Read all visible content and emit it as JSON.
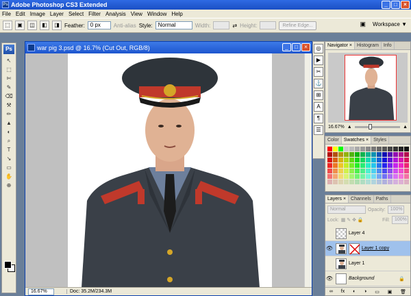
{
  "app": {
    "title": "Adobe Photoshop CS3 Extended",
    "window_buttons": [
      "_",
      "□",
      "×"
    ]
  },
  "menu": [
    "File",
    "Edit",
    "Image",
    "Layer",
    "Select",
    "Filter",
    "Analysis",
    "View",
    "Window",
    "Help"
  ],
  "options_bar": {
    "feather_label": "Feather:",
    "feather_value": "0 px",
    "antialias_label": "Anti-alias",
    "style_label": "Style:",
    "style_value": "Normal",
    "width_label": "Width:",
    "height_label": "Height:",
    "refine_label": "Refine Edge...",
    "workspace_label": "Workspace ▼"
  },
  "toolbox": {
    "logo": "Ps",
    "tools": [
      "↖",
      "⬚",
      "✄",
      "✎",
      "⌫",
      "⚒",
      "✏",
      "▲",
      "◐",
      "⌕",
      "T",
      "↘",
      "▭",
      "✋",
      "⊕"
    ]
  },
  "document": {
    "title": "war pig 3.psd @ 16.7% (Cut Out, RGB/8)",
    "zoom": "16.67%",
    "info": "Doc: 35.2M/234.3M"
  },
  "dock_icons": [
    "◎",
    "▶",
    "✂",
    "⚓",
    "⊞",
    "A",
    "¶",
    "☰"
  ],
  "navigator": {
    "tabs": [
      "Navigator ×",
      "Histogram",
      "Info"
    ],
    "zoom": "16.67%"
  },
  "swatches": {
    "tabs": [
      "Color",
      "Swatches ×",
      "Styles"
    ]
  },
  "layers": {
    "tabs": [
      "Layers ×",
      "Channels",
      "Paths"
    ],
    "blend_mode": "Normal",
    "opacity_label": "Opacity:",
    "opacity_value": "100%",
    "lock_label": "Lock:",
    "fill_label": "Fill:",
    "fill_value": "100%",
    "items": [
      {
        "name": "Layer 4",
        "visible": false,
        "selected": false
      },
      {
        "name": "Layer 1 copy",
        "visible": true,
        "selected": true
      },
      {
        "name": "Layer 1",
        "visible": false,
        "selected": false
      },
      {
        "name": "Background",
        "visible": true,
        "selected": false
      }
    ],
    "footer_icons": [
      "∞",
      "fx",
      "◐",
      "◑",
      "▭",
      "▣",
      "🗑"
    ]
  },
  "colors": {
    "title_bar": "#1a4fc4",
    "uniform_dark": "#3a4048",
    "cap_band": "#c0392b",
    "gold": "#d4a628"
  }
}
